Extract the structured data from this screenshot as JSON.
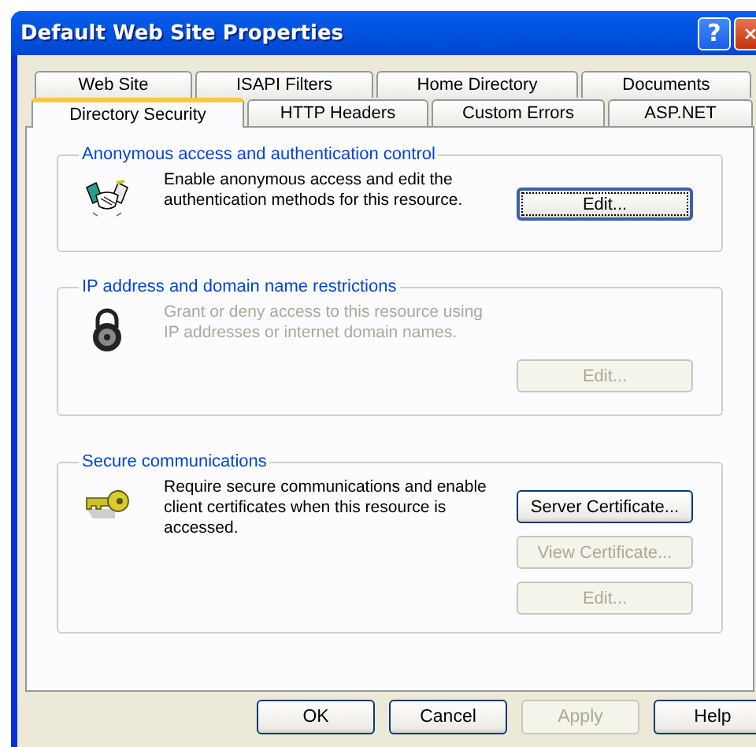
{
  "window": {
    "title": "Default Web Site Properties"
  },
  "title_buttons": [
    {
      "kind": "help",
      "label": "?"
    },
    {
      "kind": "close"
    }
  ],
  "tab_rows": [
    {
      "tabs": [
        {
          "label": "Web Site",
          "selected": false
        },
        {
          "label": "ISAPI Filters",
          "selected": false
        },
        {
          "label": "Home Directory",
          "selected": false
        },
        {
          "label": "Documents",
          "selected": false
        }
      ]
    },
    {
      "tabs": [
        {
          "label": "Directory Security",
          "selected": true
        },
        {
          "label": "HTTP Headers",
          "selected": false
        },
        {
          "label": "Custom Errors",
          "selected": false
        },
        {
          "label": "ASP.NET",
          "selected": false
        }
      ]
    }
  ],
  "groups": [
    {
      "title": "Anonymous access and authentication control",
      "kind": "handshake",
      "disabled": false,
      "description": "Enable anonymous access and edit the authentication methods for this resource.",
      "buttons": [
        {
          "label": "Edit...",
          "disabled": false,
          "default": true
        }
      ]
    },
    {
      "title": "IP address and domain name restrictions",
      "kind": "padlock",
      "disabled": true,
      "description": "Grant or deny access to this resource using IP addresses or internet domain names.",
      "buttons": [
        {
          "label": "Edit...",
          "disabled": true,
          "default": false
        }
      ]
    },
    {
      "title": "Secure communications",
      "kind": "key",
      "disabled": false,
      "description": "Require secure communications and enable client certificates when this resource is accessed.",
      "buttons": [
        {
          "label": "Server Certificate...",
          "disabled": false,
          "default": false
        },
        {
          "label": "View Certificate...",
          "disabled": true,
          "default": false
        },
        {
          "label": "Edit...",
          "disabled": true,
          "default": false
        }
      ]
    }
  ],
  "buttons": [
    {
      "label": "OK",
      "disabled": false
    },
    {
      "label": "Cancel",
      "disabled": false
    },
    {
      "label": "Apply",
      "disabled": true
    },
    {
      "label": "Help",
      "disabled": false
    }
  ]
}
